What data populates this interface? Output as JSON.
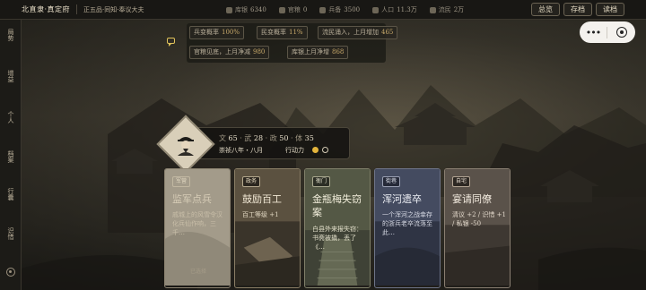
{
  "header": {
    "region": "北直隶·真定府",
    "rank": "正五品·同知·奉议大夫",
    "stats": [
      {
        "icon": "treasury-icon",
        "label": "库银",
        "value": "6340"
      },
      {
        "icon": "grain-icon",
        "label": "官粮",
        "value": "0"
      },
      {
        "icon": "soldier-icon",
        "label": "兵备",
        "value": "3500"
      },
      {
        "icon": "population-icon",
        "label": "人口",
        "value": "11.3万"
      },
      {
        "icon": "refugee-icon",
        "label": "流民",
        "value": "2万"
      }
    ],
    "buttons": [
      "总览",
      "存档",
      "读档"
    ]
  },
  "sidebar": {
    "items": [
      "局势",
      "增益",
      "个人",
      "档案",
      "行囊",
      "识惜"
    ]
  },
  "notices": [
    {
      "label": "兵变概率",
      "value": "100%"
    },
    {
      "label": "民变概率",
      "value": "11%"
    },
    {
      "label": "流民涌入，上月增加",
      "value": "465"
    },
    {
      "label": "官粮见底，上月净减",
      "value": "980"
    },
    {
      "label": "库银上月净增",
      "value": "868"
    }
  ],
  "hero": {
    "attrs": [
      {
        "label": "文",
        "value": "65"
      },
      {
        "label": "武",
        "value": "28"
      },
      {
        "label": "政",
        "value": "50"
      },
      {
        "label": "体",
        "value": "35"
      }
    ],
    "date": "崇祯八年・八月",
    "action_label": "行动力",
    "action_total": 2,
    "action_used": 1
  },
  "cards": [
    {
      "tag": "军营",
      "title": "监军点兵",
      "desc": "戚城上的风雪令汉化兵仙作响，三千…",
      "foot": "已选择"
    },
    {
      "tag": "政务",
      "title": "鼓励百工",
      "desc": "百工等级 +1",
      "foot": ""
    },
    {
      "tag": "衙门",
      "title": "金瓶梅失窃案",
      "desc": "白县外来报失窃：书斋被撬，丢了《…",
      "foot": ""
    },
    {
      "tag": "街巷",
      "title": "浑河遗卒",
      "desc": "一个浑河之战幸存的浙兵老卒流落至此…",
      "foot": ""
    },
    {
      "tag": "自宅",
      "title": "宴请同僚",
      "desc": "清议 +2 / 识惜 +1 / 私银 -50",
      "foot": ""
    }
  ],
  "colors": {
    "accent": "#e3b43c",
    "number": "#c8a96a"
  }
}
